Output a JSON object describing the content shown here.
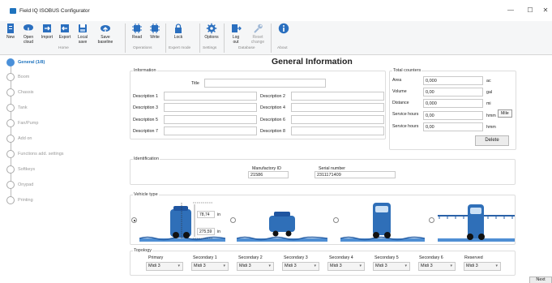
{
  "window": {
    "title": "Field IQ ISOBUS Configurator",
    "minimize": "—",
    "maximize": "☐",
    "close": "✕"
  },
  "ribbon": {
    "buttons": [
      {
        "label": "New"
      },
      {
        "label": "Open\ncloud"
      },
      {
        "label": "Import"
      },
      {
        "label": "Export"
      },
      {
        "label": "Local\nsave"
      },
      {
        "label": "Save\nbaseline"
      },
      {
        "label": "Read"
      },
      {
        "label": "Write"
      },
      {
        "label": "Lock"
      },
      {
        "label": "Options"
      },
      {
        "label": "Log\nout"
      },
      {
        "label": "Reset\nchange"
      },
      {
        "label": "About"
      }
    ],
    "groups": [
      "Home",
      "Operations",
      "Expert mode",
      "Settings",
      "Database",
      "About"
    ]
  },
  "sidebar": {
    "steps": [
      "General (1/8)",
      "Boom",
      "Chassis",
      "Tank",
      "Fan/Pump",
      "Add on",
      "Functions add. settings",
      "Softkeys",
      "Onypad",
      "Printing"
    ]
  },
  "page_title": "General Information",
  "information": {
    "legend": "Information",
    "title_label": "Title",
    "title_value": "",
    "descriptions": [
      {
        "label": "Description 1",
        "value": ""
      },
      {
        "label": "Description 2",
        "value": ""
      },
      {
        "label": "Description 3",
        "value": ""
      },
      {
        "label": "Description 4",
        "value": ""
      },
      {
        "label": "Description 5",
        "value": ""
      },
      {
        "label": "Description 6",
        "value": ""
      },
      {
        "label": "Description 7",
        "value": ""
      },
      {
        "label": "Description 8",
        "value": ""
      }
    ]
  },
  "counters": {
    "legend": "Total counters",
    "rows": [
      {
        "label": "Area",
        "value": "0,000",
        "unit": "ac"
      },
      {
        "label": "Volume",
        "value": "0,00",
        "unit": "gal"
      },
      {
        "label": "Distance",
        "value": "0,000",
        "unit": "mi"
      },
      {
        "label": "Service hours",
        "value": "0,00",
        "unit": "hmm"
      },
      {
        "label": "Service hours",
        "value": "0,00",
        "unit": "hmm"
      }
    ],
    "tooltip": "Mile",
    "delete_label": "Delete"
  },
  "identification": {
    "legend": "Identification",
    "manufactory_label": "Manufactory ID",
    "manufactory_value": "21586",
    "serial_label": "Serial number",
    "serial_value": "2311171409"
  },
  "vehicle": {
    "legend": "Vehicle type",
    "dim1_value": "78,74",
    "dim1_unit": "in",
    "dim2_value": "275,59",
    "dim2_unit": "in",
    "selected_index": 0,
    "colors": {
      "body": "#2f6fb8",
      "boom": "#2a62a8",
      "grass": "#4f8fd4"
    }
  },
  "topology": {
    "legend": "Topology",
    "columns": [
      {
        "label": "Primary",
        "value": "Midi 3"
      },
      {
        "label": "Secondary 1",
        "value": "Midi 3"
      },
      {
        "label": "Secondary 2",
        "value": "Midi 3"
      },
      {
        "label": "Secondary 3",
        "value": "Midi 3"
      },
      {
        "label": "Secondary 4",
        "value": "Midi 3"
      },
      {
        "label": "Secondary 5",
        "value": "Midi 3"
      },
      {
        "label": "Secondary 6",
        "value": "Midi 3"
      },
      {
        "label": "Reserved",
        "value": "Midi 3"
      }
    ]
  },
  "next_label": "Next"
}
